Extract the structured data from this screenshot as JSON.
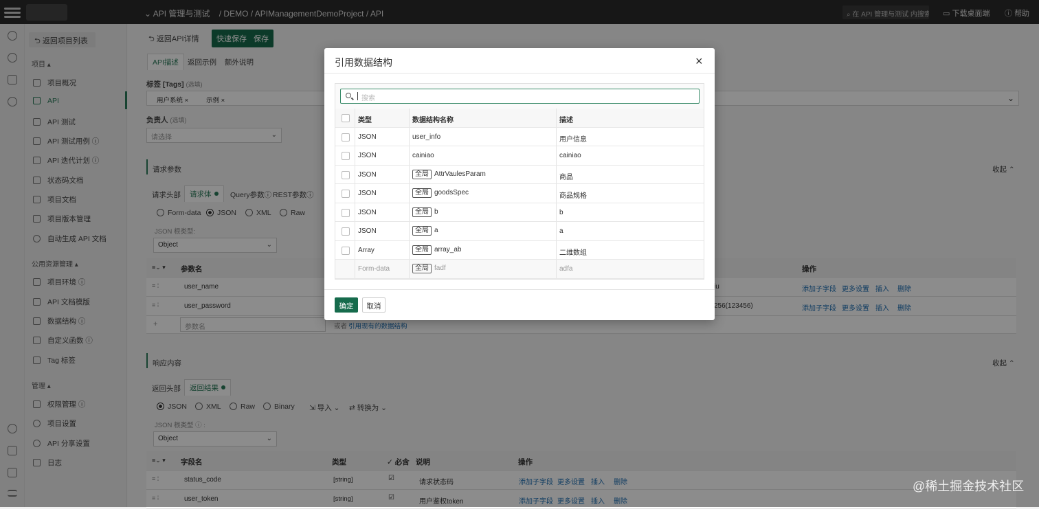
{
  "topbar": {
    "crumb_project": "API 管理与测试",
    "crumb_path": "/ DEMO / APIManagementDemoProject / API",
    "search_placeholder": "在 API 管理与测试 内搜索",
    "download": "下载桌面端",
    "help": "帮助"
  },
  "sidebar": {
    "back": "返回项目列表",
    "group_project": "项目",
    "items_project": [
      "项目概况",
      "API",
      "API 测试",
      "API 测试用例",
      "API 迭代计划",
      "状态码文档",
      "项目文档",
      "项目版本管理",
      "自动生成 API 文档"
    ],
    "group_public": "公用资源管理",
    "items_public": [
      "项目环境",
      "API 文档模版",
      "数据结构",
      "自定义函数",
      "Tag 标签"
    ],
    "group_manage": "管理",
    "items_manage": [
      "权限管理",
      "项目设置",
      "API 分享设置",
      "日志"
    ]
  },
  "main": {
    "back_detail": "返回API详情",
    "quick_save": "快速保存",
    "save": "保存",
    "tabs": [
      "API描述",
      "返回示例",
      "额外说明"
    ],
    "tags_label": "标签 [Tags]",
    "tags_optional": "(选填)",
    "tag_values": [
      "用户系统",
      "示例"
    ],
    "owner_label": "负责人",
    "owner_optional": "(选填)",
    "owner_placeholder": "请选择",
    "req_section": "请求参数",
    "collapse": "收起",
    "req_tabs": [
      "请求头部",
      "请求体",
      "Query参数",
      "REST参数"
    ],
    "req_formats": [
      "Form-data",
      "JSON",
      "XML",
      "Raw"
    ],
    "json_root_label": "JSON 根类型:",
    "json_root_value": "Object",
    "param_col": "参数名",
    "ops_col": "操作",
    "params": [
      {
        "name": "user_name",
        "tail": "iu"
      },
      {
        "name": "user_password",
        "tail": "256(123456)"
      }
    ],
    "param_name_placeholder": "参数名",
    "or_text": "或者",
    "ref_link": "引用现有的数据结构",
    "row_actions": [
      "添加子字段",
      "更多设置",
      "插入",
      "删除"
    ],
    "resp_section": "响应内容",
    "resp_tabs": [
      "返回头部",
      "返回结果"
    ],
    "resp_formats": [
      "JSON",
      "XML",
      "Raw",
      "Binary"
    ],
    "import": "导入",
    "convert": "转换为",
    "resp_root_label": "JSON 根类型",
    "resp_root_value": "Object",
    "resp_cols": [
      "字段名",
      "类型",
      "必含",
      "说明",
      "操作"
    ],
    "resp_rows": [
      {
        "name": "status_code",
        "type": "[string]",
        "desc": "请求状态码"
      },
      {
        "name": "user_token",
        "type": "[string]",
        "desc": "用户鉴权token"
      }
    ]
  },
  "modal": {
    "title": "引用数据结构",
    "search_placeholder": "搜索",
    "columns": [
      "类型",
      "数据结构名称",
      "描述"
    ],
    "rows": [
      {
        "type": "JSON",
        "global": false,
        "name": "user_info",
        "desc": "用户信息"
      },
      {
        "type": "JSON",
        "global": false,
        "name": "cainiao",
        "desc": "cainiao"
      },
      {
        "type": "JSON",
        "global": true,
        "name": "AttrVaulesParam",
        "desc": "商品"
      },
      {
        "type": "JSON",
        "global": true,
        "name": "goodsSpec",
        "desc": "商品规格"
      },
      {
        "type": "JSON",
        "global": true,
        "name": "b",
        "desc": "b"
      },
      {
        "type": "JSON",
        "global": true,
        "name": "a",
        "desc": "a"
      },
      {
        "type": "Array",
        "global": true,
        "name": "array_ab",
        "desc": "二维数组"
      },
      {
        "type": "Form-data",
        "global": true,
        "name": "fadf",
        "desc": "adfa"
      }
    ],
    "global_badge": "全局",
    "ok": "确定",
    "cancel": "取消"
  },
  "watermark": "@稀土掘金技术社区"
}
